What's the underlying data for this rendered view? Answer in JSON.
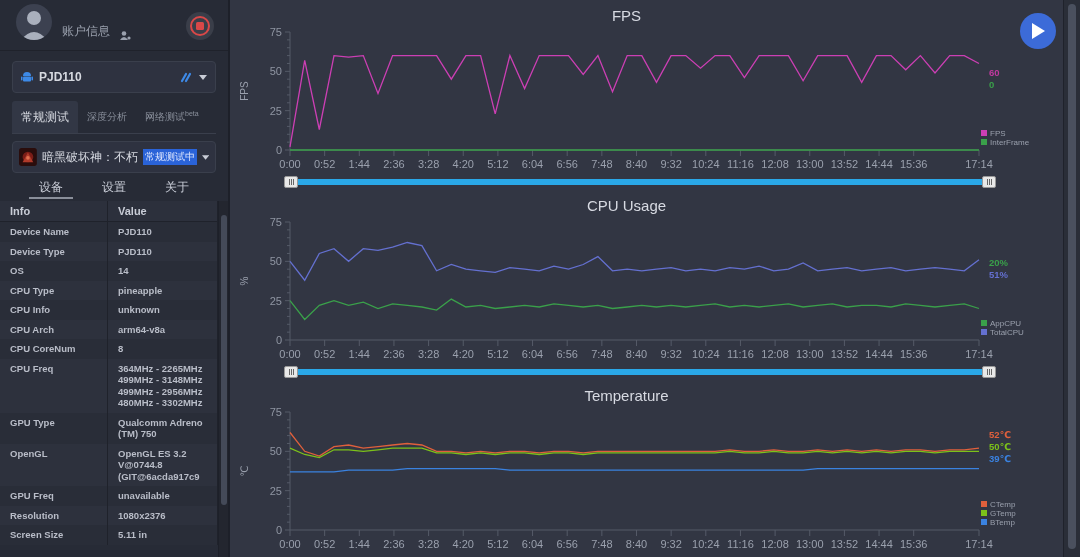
{
  "sidebar": {
    "account_label": "账户信息",
    "device": {
      "name": "PJD110"
    },
    "tabs": [
      {
        "label": "常规测试",
        "selected": true
      },
      {
        "label": "深度分析",
        "selected": false
      },
      {
        "label": "网络测试$^{beta}$",
        "selected": false
      }
    ],
    "app": {
      "name": "暗黑破坏神：不朽",
      "badge": "常规测试中"
    },
    "subtabs": [
      {
        "label": "设备",
        "selected": true
      },
      {
        "label": "设置",
        "selected": false
      },
      {
        "label": "关于",
        "selected": false
      }
    ],
    "table": {
      "columns": [
        "Info",
        "Value"
      ],
      "rows": [
        {
          "info": "Device Name",
          "value": "PJD110"
        },
        {
          "info": "Device Type",
          "value": "PJD110"
        },
        {
          "info": "OS",
          "value": "14"
        },
        {
          "info": "CPU Type",
          "value": "pineapple"
        },
        {
          "info": "CPU Info",
          "value": "unknown"
        },
        {
          "info": "CPU Arch",
          "value": "arm64-v8a"
        },
        {
          "info": "CPU CoreNum",
          "value": "8"
        },
        {
          "info": "CPU Freq",
          "value": "364MHz - 2265MHz\n499MHz - 3148MHz\n499MHz - 2956MHz\n480MHz - 3302MHz"
        },
        {
          "info": "GPU Type",
          "value": "Qualcomm Adreno\n(TM) 750"
        },
        {
          "info": "OpenGL",
          "value": "OpenGL ES 3.2\nV@0744.8\n(GIT@6acda917c9"
        },
        {
          "info": "GPU Freq",
          "value": "unavailable"
        },
        {
          "info": "Resolution",
          "value": "1080x2376"
        },
        {
          "info": "Screen Size",
          "value": "5.11 in"
        }
      ]
    }
  },
  "charts": [
    {
      "title": "FPS",
      "readings": [
        {
          "text": "60",
          "color": "#c0399f"
        },
        {
          "text": "0",
          "color": "#3aa04a"
        }
      ],
      "slider": {
        "level": 1
      },
      "chart_data": {
        "type": "line",
        "ylabel": "FPS",
        "legend": true,
        "xlim": [
          0,
          1034
        ],
        "ylim": [
          0,
          75
        ],
        "yticks": [
          0,
          25,
          50,
          75
        ],
        "xticks": [
          {
            "value": 0,
            "label": "0:00"
          },
          {
            "value": 52,
            "label": "0:52"
          },
          {
            "value": 104,
            "label": "1:44"
          },
          {
            "value": 156,
            "label": "2:36"
          },
          {
            "value": 208,
            "label": "3:28"
          },
          {
            "value": 260,
            "label": "4:20"
          },
          {
            "value": 312,
            "label": "5:12"
          },
          {
            "value": 364,
            "label": "6:04"
          },
          {
            "value": 416,
            "label": "6:56"
          },
          {
            "value": 468,
            "label": "7:48"
          },
          {
            "value": 520,
            "label": "8:40"
          },
          {
            "value": 572,
            "label": "9:32"
          },
          {
            "value": 624,
            "label": "10:24"
          },
          {
            "value": 676,
            "label": "11:16"
          },
          {
            "value": 728,
            "label": "12:08"
          },
          {
            "value": 780,
            "label": "13:00"
          },
          {
            "value": 832,
            "label": "13:52"
          },
          {
            "value": 884,
            "label": "14:44"
          },
          {
            "value": 936,
            "label": "15:36"
          },
          {
            "value": 1034,
            "label": "17:14"
          }
        ],
        "x": [
          0,
          22,
          44,
          66,
          88,
          110,
          132,
          154,
          176,
          198,
          220,
          242,
          264,
          286,
          308,
          330,
          352,
          374,
          396,
          418,
          440,
          462,
          484,
          506,
          528,
          550,
          572,
          594,
          616,
          638,
          660,
          682,
          704,
          726,
          748,
          770,
          792,
          814,
          836,
          858,
          880,
          902,
          924,
          946,
          968,
          990,
          1012,
          1034
        ],
        "series": [
          {
            "name": "FPS",
            "color": "#cc3fb4",
            "values": [
              2,
              57,
              13,
              60,
              59,
              60,
              36,
              60,
              60,
              60,
              60,
              45,
              60,
              60,
              23,
              60,
              39,
              60,
              60,
              60,
              48,
              60,
              37,
              60,
              60,
              43,
              60,
              60,
              52,
              60,
              60,
              46,
              60,
              60,
              60,
              44,
              60,
              60,
              60,
              43,
              60,
              60,
              51,
              60,
              49,
              60,
              60,
              55
            ]
          },
          {
            "name": "InterFrame",
            "color": "#3aa04a",
            "values": [
              0,
              0,
              0,
              0,
              0,
              0,
              0,
              0,
              0,
              0,
              0,
              0,
              0,
              0,
              0,
              0,
              0,
              0,
              0,
              0,
              0,
              0,
              0,
              0,
              0,
              0,
              0,
              0,
              0,
              0,
              0,
              0,
              0,
              0,
              0,
              0,
              0,
              0,
              0,
              0,
              0,
              0,
              0,
              0,
              0,
              0,
              0,
              0
            ]
          }
        ]
      }
    },
    {
      "title": "CPU Usage",
      "readings": [
        {
          "text": "20%",
          "color": "#3aa04a"
        },
        {
          "text": "51%",
          "color": "#6470d0"
        }
      ],
      "slider": {
        "level": 1
      },
      "chart_data": {
        "type": "line",
        "ylabel": "%",
        "legend": true,
        "xlim": [
          0,
          1034
        ],
        "ylim": [
          0,
          75
        ],
        "yticks": [
          0,
          25,
          50,
          75
        ],
        "xticks": [
          {
            "value": 0,
            "label": "0:00"
          },
          {
            "value": 52,
            "label": "0:52"
          },
          {
            "value": 104,
            "label": "1:44"
          },
          {
            "value": 156,
            "label": "2:36"
          },
          {
            "value": 208,
            "label": "3:28"
          },
          {
            "value": 260,
            "label": "4:20"
          },
          {
            "value": 312,
            "label": "5:12"
          },
          {
            "value": 364,
            "label": "6:04"
          },
          {
            "value": 416,
            "label": "6:56"
          },
          {
            "value": 468,
            "label": "7:48"
          },
          {
            "value": 520,
            "label": "8:40"
          },
          {
            "value": 572,
            "label": "9:32"
          },
          {
            "value": 624,
            "label": "10:24"
          },
          {
            "value": 676,
            "label": "11:16"
          },
          {
            "value": 728,
            "label": "12:08"
          },
          {
            "value": 780,
            "label": "13:00"
          },
          {
            "value": 832,
            "label": "13:52"
          },
          {
            "value": 884,
            "label": "14:44"
          },
          {
            "value": 936,
            "label": "15:36"
          },
          {
            "value": 1034,
            "label": "17:14"
          }
        ],
        "x": [
          0,
          22,
          44,
          66,
          88,
          110,
          132,
          154,
          176,
          198,
          220,
          242,
          264,
          286,
          308,
          330,
          352,
          374,
          396,
          418,
          440,
          462,
          484,
          506,
          528,
          550,
          572,
          594,
          616,
          638,
          660,
          682,
          704,
          726,
          748,
          770,
          792,
          814,
          836,
          858,
          880,
          902,
          924,
          946,
          968,
          990,
          1012,
          1034
        ],
        "series": [
          {
            "name": "AppCPU",
            "color": "#3aa04a",
            "values": [
              25,
              13,
              22,
              25,
              22,
              24,
              20,
              23,
              22,
              21,
              19,
              26,
              21,
              22,
              20,
              21,
              22,
              21,
              23,
              22,
              21,
              22,
              20,
              21,
              22,
              21,
              22,
              21,
              22,
              23,
              21,
              22,
              21,
              22,
              23,
              21,
              22,
              23,
              21,
              22,
              22,
              21,
              23,
              22,
              21,
              22,
              23,
              20
            ]
          },
          {
            "name": "TotalCPU",
            "color": "#6470d0",
            "values": [
              50,
              38,
              55,
              58,
              50,
              58,
              57,
              59,
              62,
              60,
              44,
              48,
              45,
              44,
              43,
              46,
              45,
              44,
              47,
              45,
              48,
              53,
              44,
              45,
              44,
              45,
              46,
              44,
              45,
              44,
              46,
              45,
              47,
              44,
              45,
              49,
              44,
              45,
              46,
              44,
              45,
              46,
              44,
              45,
              46,
              45,
              44,
              51
            ]
          }
        ]
      }
    },
    {
      "title": "Temperature",
      "readings": [
        {
          "text": "52℃",
          "color": "#e0603c"
        },
        {
          "text": "50℃",
          "color": "#7cc11a"
        },
        {
          "text": "39℃",
          "color": "#3a82e0"
        }
      ],
      "chart_data": {
        "type": "line",
        "ylabel": "℃",
        "legend": true,
        "xlim": [
          0,
          1034
        ],
        "ylim": [
          0,
          75
        ],
        "yticks": [
          0,
          25,
          50,
          75
        ],
        "xticks": [
          {
            "value": 0,
            "label": "0:00"
          },
          {
            "value": 52,
            "label": "0:52"
          },
          {
            "value": 104,
            "label": "1:44"
          },
          {
            "value": 156,
            "label": "2:36"
          },
          {
            "value": 208,
            "label": "3:28"
          },
          {
            "value": 260,
            "label": "4:20"
          },
          {
            "value": 312,
            "label": "5:12"
          },
          {
            "value": 364,
            "label": "6:04"
          },
          {
            "value": 416,
            "label": "6:56"
          },
          {
            "value": 468,
            "label": "7:48"
          },
          {
            "value": 520,
            "label": "8:40"
          },
          {
            "value": 572,
            "label": "9:32"
          },
          {
            "value": 624,
            "label": "10:24"
          },
          {
            "value": 676,
            "label": "11:16"
          },
          {
            "value": 728,
            "label": "12:08"
          },
          {
            "value": 780,
            "label": "13:00"
          },
          {
            "value": 832,
            "label": "13:52"
          },
          {
            "value": 884,
            "label": "14:44"
          },
          {
            "value": 936,
            "label": "15:36"
          },
          {
            "value": 1034,
            "label": "17:14"
          }
        ],
        "x": [
          0,
          22,
          44,
          66,
          88,
          110,
          132,
          154,
          176,
          198,
          220,
          242,
          264,
          286,
          308,
          330,
          352,
          374,
          396,
          418,
          440,
          462,
          484,
          506,
          528,
          550,
          572,
          594,
          616,
          638,
          660,
          682,
          704,
          726,
          748,
          770,
          792,
          814,
          836,
          858,
          880,
          902,
          924,
          946,
          968,
          990,
          1012,
          1034
        ],
        "series": [
          {
            "name": "CTemp",
            "color": "#e0603c",
            "values": [
              62,
              50,
              47,
              53,
              54,
              52,
              53,
              54,
              55,
              54,
              50,
              50,
              49,
              50,
              49,
              50,
              50,
              49,
              50,
              50,
              49,
              50,
              50,
              50,
              50,
              50,
              50,
              50,
              50,
              50,
              51,
              50,
              50,
              51,
              50,
              50,
              51,
              50,
              51,
              50,
              51,
              50,
              51,
              51,
              50,
              51,
              51,
              52
            ]
          },
          {
            "name": "GTemp",
            "color": "#7cc11a",
            "values": [
              52,
              48,
              46,
              51,
              51,
              50,
              51,
              52,
              52,
              52,
              49,
              49,
              48,
              49,
              48,
              49,
              49,
              48,
              49,
              49,
              48,
              49,
              49,
              49,
              49,
              49,
              49,
              49,
              49,
              49,
              50,
              49,
              49,
              50,
              49,
              49,
              50,
              49,
              50,
              49,
              50,
              49,
              50,
              50,
              49,
              50,
              50,
              50
            ]
          },
          {
            "name": "BTemp",
            "color": "#3a82e0",
            "values": [
              37,
              37,
              37,
              37,
              38,
              38,
              38,
              38,
              39,
              39,
              39,
              39,
              39,
              39,
              39,
              38,
              38,
              38,
              38,
              38,
              38,
              38,
              38,
              38,
              38,
              38,
              38,
              38,
              38,
              38,
              38,
              38,
              38,
              38,
              38,
              38,
              39,
              39,
              39,
              39,
              39,
              39,
              39,
              39,
              39,
              39,
              39,
              39
            ]
          }
        ]
      }
    }
  ]
}
